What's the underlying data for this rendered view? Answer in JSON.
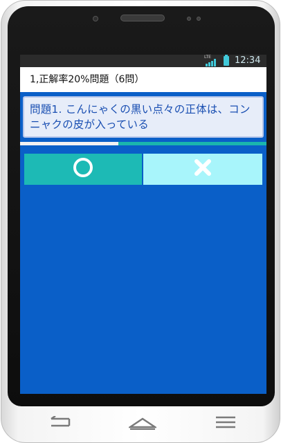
{
  "status_bar": {
    "network": "LTE",
    "time": "12:34"
  },
  "app_bar": {
    "title": "1,正解率20%問題（6問）"
  },
  "question": {
    "text": "問題1. こんにゃくの黒い点々の正体は、コンニャクの皮が入っている"
  },
  "progress": {
    "fraction": 0.4
  },
  "answers": {
    "correct_label": "〇",
    "wrong_label": "✖"
  },
  "nav_bar": {
    "back_icon": "back-arrow-icon",
    "home_icon": "home-icon",
    "menu_icon": "menu-icon"
  },
  "colors": {
    "screen_bg": "#0a5fc8",
    "correct_button": "#1dbab5",
    "wrong_button": "#a8f5fb",
    "question_text": "#1a4fb2",
    "progress_track": "#1ab6ad",
    "status_accent": "#41c9d9"
  }
}
